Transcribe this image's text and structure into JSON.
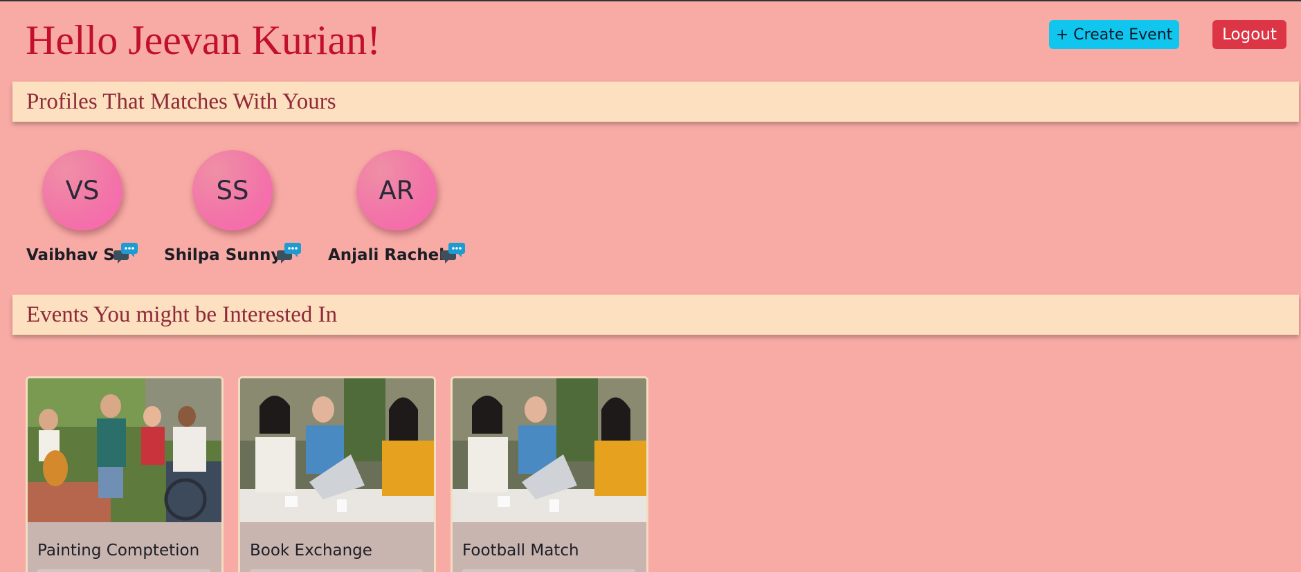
{
  "header": {
    "greeting": "Hello Jeevan Kurian!",
    "create_event_label": "+ Create Event",
    "logout_label": "Logout"
  },
  "profiles_section": {
    "title": "Profiles That Matches With Yours",
    "profiles": [
      {
        "initials": "VS",
        "name": "Vaibhav S",
        "chat_icon": "chat-bubbles-icon"
      },
      {
        "initials": "SS",
        "name": "Shilpa Sunny",
        "chat_icon": "chat-bubbles-icon"
      },
      {
        "initials": "AR",
        "name": "Anjali Rachel",
        "chat_icon": "chat-bubbles-icon"
      }
    ]
  },
  "events_section": {
    "title": "Events You might be Interested In",
    "events": [
      {
        "title": "Painting Comptetion",
        "image": "friends-with-guitar-photo"
      },
      {
        "title": "Book Exchange",
        "image": "people-at-cafe-laptop-photo"
      },
      {
        "title": "Football Match",
        "image": "people-at-cafe-laptop-photo"
      }
    ]
  },
  "colors": {
    "background": "#f8aba5",
    "section_bar": "#fde0bf",
    "greeting_text": "#c0102e",
    "create_button": "#10c6ee",
    "logout_button": "#dc3545",
    "avatar": "#f275a8",
    "card": "#c8b5b0"
  }
}
